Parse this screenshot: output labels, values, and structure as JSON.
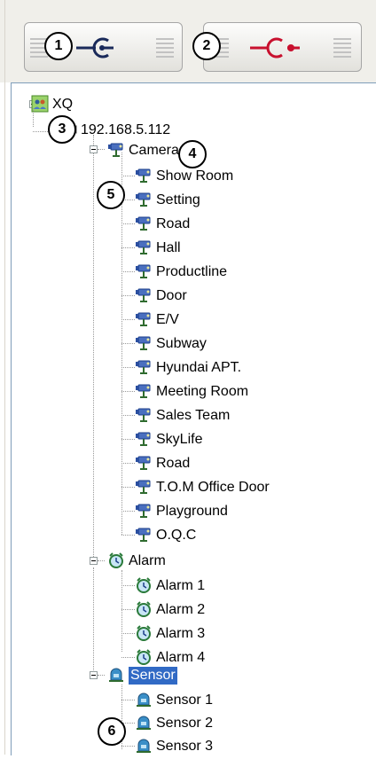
{
  "markers": [
    "1",
    "2",
    "3",
    "4",
    "5",
    "6"
  ],
  "tree": {
    "root": "XQ",
    "server": "192.168.5.112",
    "cameras_group": "Camera",
    "cameras": [
      "Show Room",
      "Setting",
      "Road",
      "Hall",
      "Productline",
      "Door",
      "E/V",
      "Subway",
      "Hyundai APT.",
      "Meeting Room",
      "Sales Team",
      "SkyLife",
      "Road",
      "T.O.M Office Door",
      "Playground",
      "O.Q.C"
    ],
    "alarm_group": "Alarm",
    "alarms": [
      "Alarm 1",
      "Alarm 2",
      "Alarm 3",
      "Alarm 4"
    ],
    "sensor_group": "Sensor",
    "sensors": [
      "Sensor 1",
      "Sensor 2",
      "Sensor 3"
    ]
  },
  "colors": {
    "connect": "#1a2a5a",
    "disconnect": "#c8102e",
    "selection": "#316ac5"
  },
  "icons": [
    "connect-icon",
    "disconnect-icon",
    "site-icon",
    "dvr-icon",
    "camera-icon",
    "alarm-icon",
    "sensor-icon"
  ]
}
